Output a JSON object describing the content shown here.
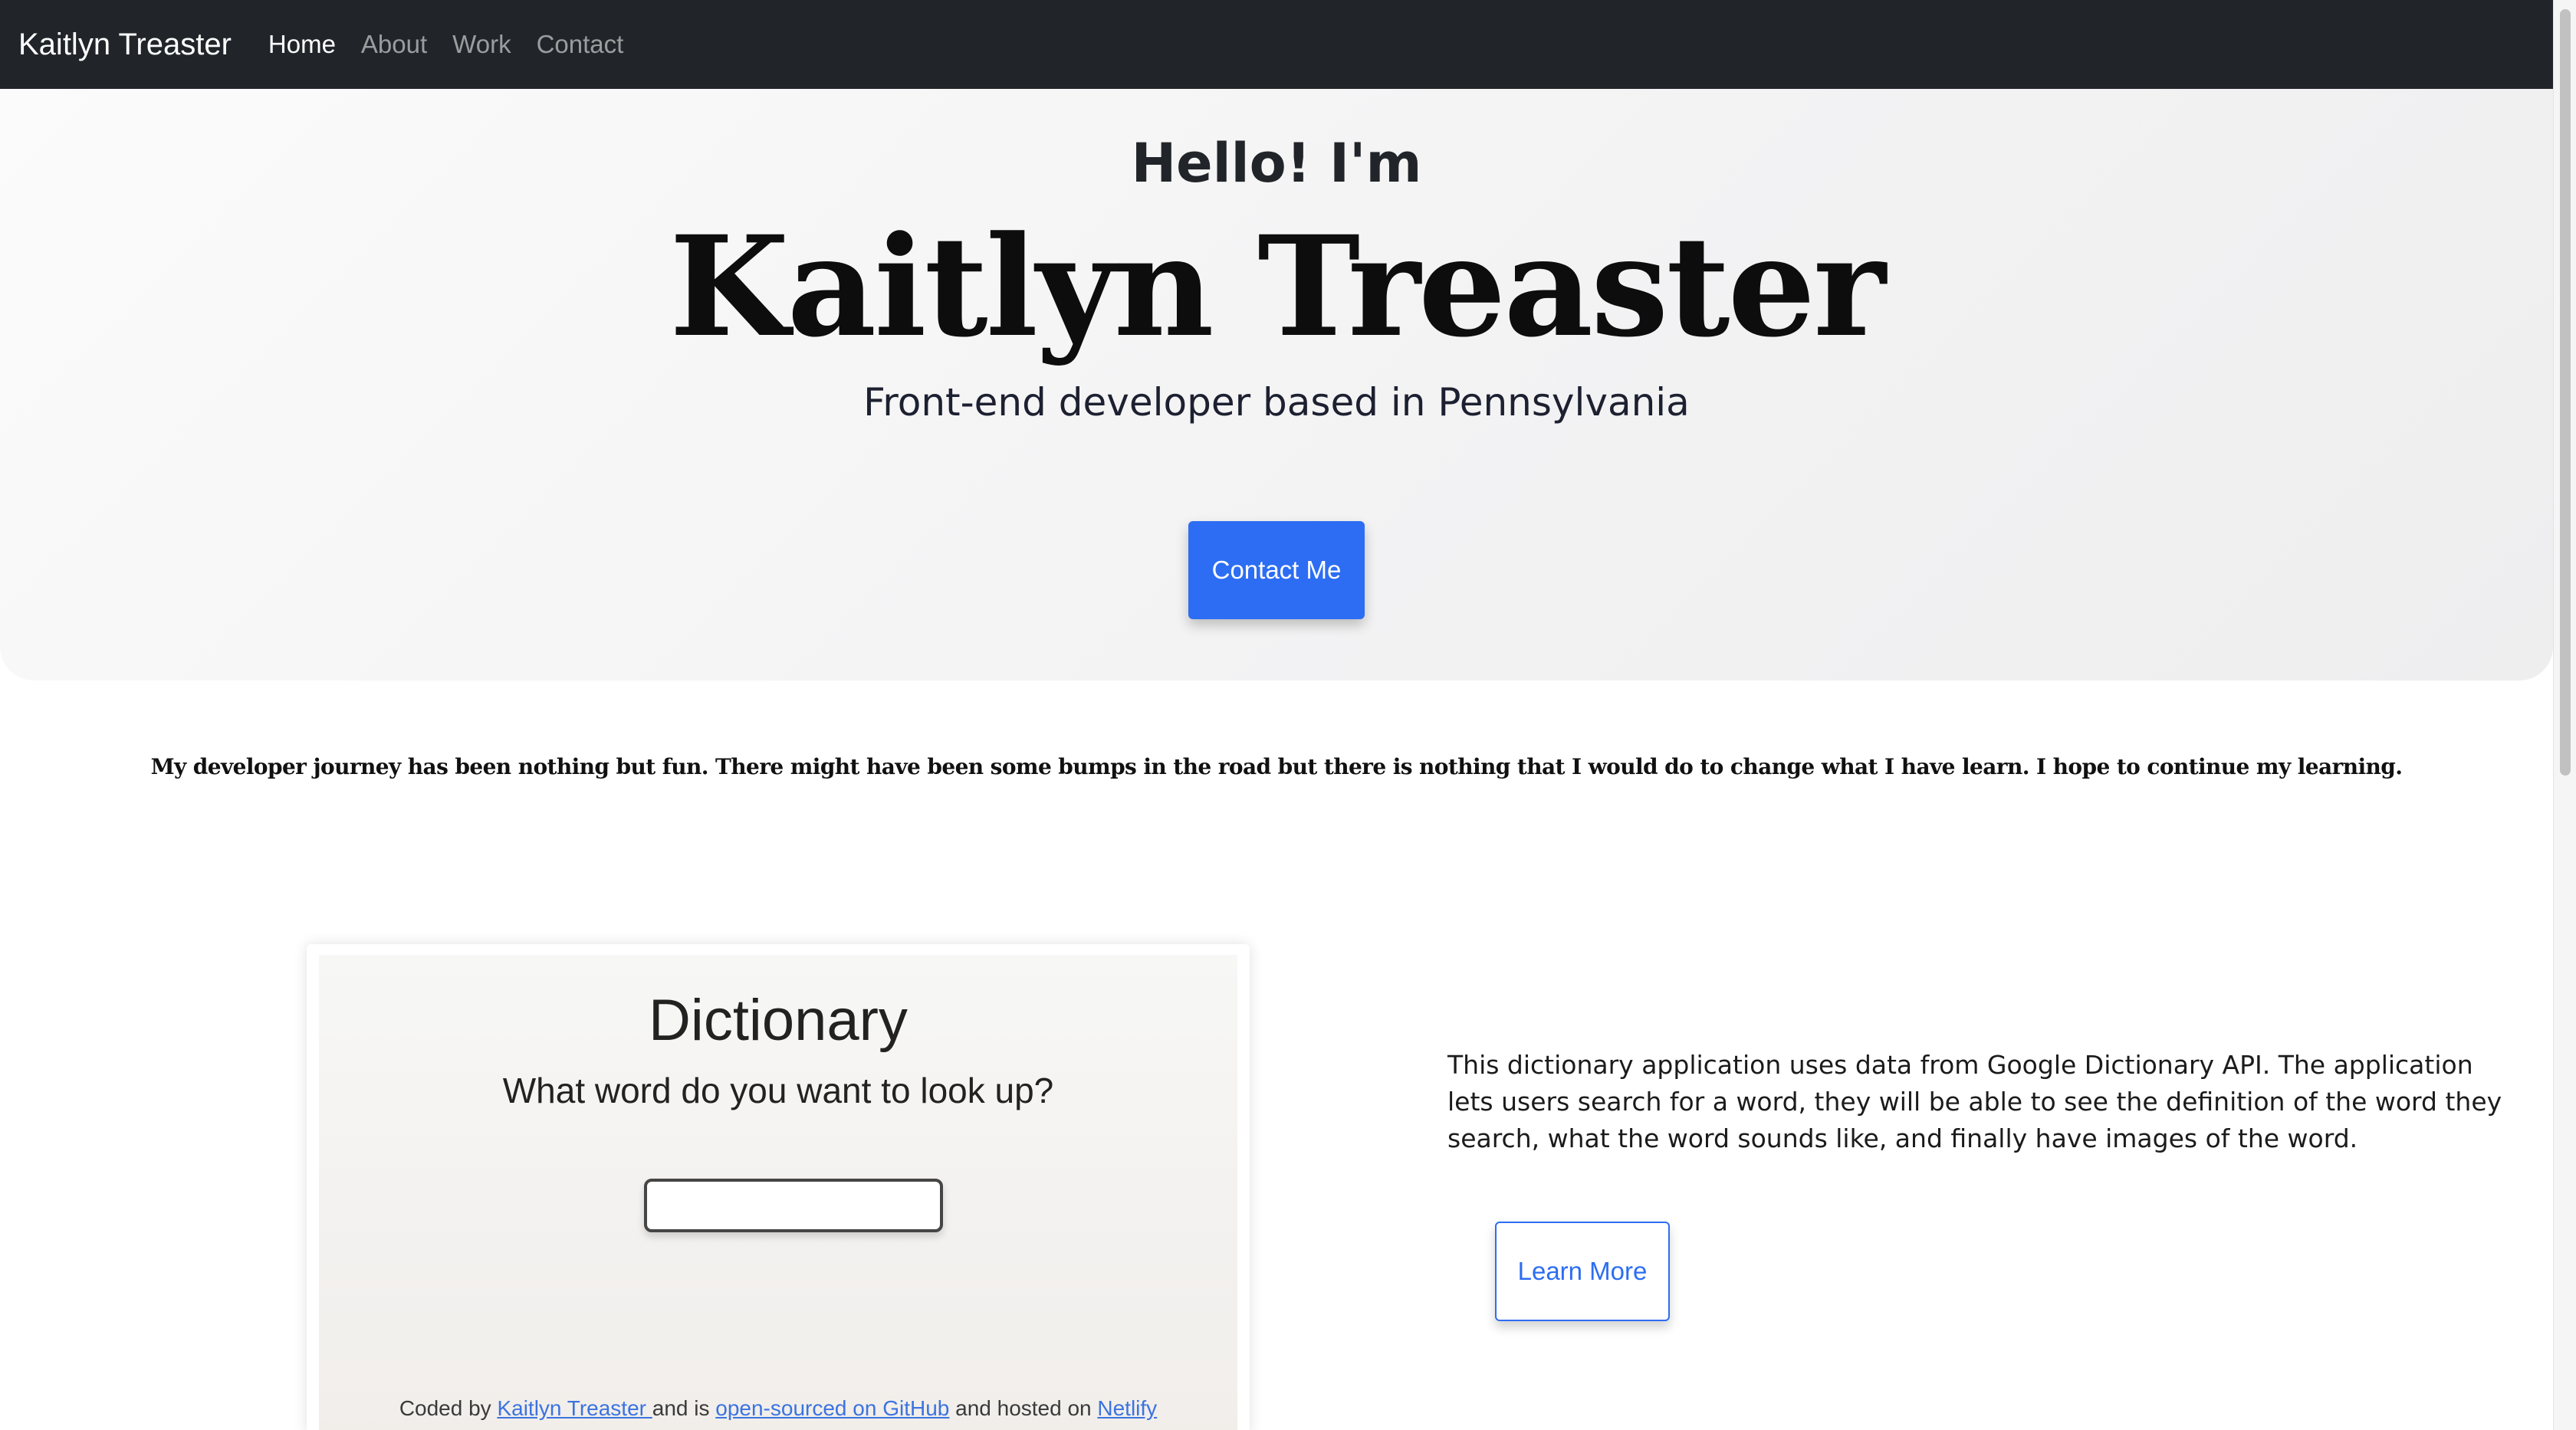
{
  "navbar": {
    "brand": "Kaitlyn Treaster",
    "links": [
      {
        "label": "Home",
        "active": true
      },
      {
        "label": "About",
        "active": false
      },
      {
        "label": "Work",
        "active": false
      },
      {
        "label": "Contact",
        "active": false
      }
    ]
  },
  "hero": {
    "greeting": "Hello! I'm",
    "name": "Kaitlyn Treaster",
    "tagline": "Front-end developer based in Pennsylvania",
    "contact_button": "Contact Me"
  },
  "intro": {
    "text": "My developer journey has been nothing but fun. There might have been some bumps in the road but there is nothing that I would do to change what I have learn. I hope to continue my learning."
  },
  "project": {
    "screenshot": {
      "title": "Dictionary",
      "subtitle": "What word do you want to look up?",
      "search_value": "",
      "footer_prefix": "Coded by ",
      "footer_author": "Kaitlyn Treaster ",
      "footer_mid1": "and is ",
      "footer_repo": "open-sourced on GitHub",
      "footer_mid2": " and hosted on ",
      "footer_host": "Netlify"
    },
    "description": "This dictionary application uses data from Google Dictionary API. The application lets users search for a word, they will be able to see the definition of the word they search, what the word sounds like, and finally have images of the word.",
    "learn_more_button": "Learn More"
  },
  "colors": {
    "navbar_bg": "#212529",
    "primary": "#2c6df3",
    "link": "#3b73e0"
  }
}
